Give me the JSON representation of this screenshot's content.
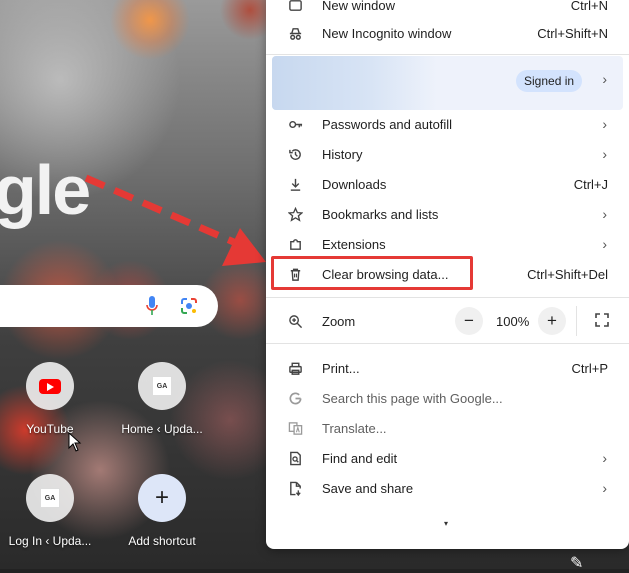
{
  "newtab": {
    "logo_fragment": "gle",
    "shortcuts": [
      {
        "label": "YouTube",
        "icon": "youtube-icon"
      },
      {
        "label": "Home ‹ Upda...",
        "icon": "site-favicon"
      },
      {
        "label": "Log In ‹ Upda...",
        "icon": "site-favicon"
      },
      {
        "label": "Add shortcut",
        "icon": "plus-icon"
      }
    ],
    "favicon_text": "GA",
    "add_glyph": "+"
  },
  "menu": {
    "new_window": {
      "label": "New window",
      "shortcut": "Ctrl+N"
    },
    "new_incognito": {
      "label": "New Incognito window",
      "shortcut": "Ctrl+Shift+N"
    },
    "profile": {
      "badge": "Signed in"
    },
    "passwords": {
      "label": "Passwords and autofill"
    },
    "history": {
      "label": "History"
    },
    "downloads": {
      "label": "Downloads",
      "shortcut": "Ctrl+J"
    },
    "bookmarks": {
      "label": "Bookmarks and lists"
    },
    "extensions": {
      "label": "Extensions"
    },
    "clear_data": {
      "label": "Clear browsing data...",
      "shortcut": "Ctrl+Shift+Del"
    },
    "zoom": {
      "label": "Zoom",
      "minus": "−",
      "value": "100%",
      "plus": "+"
    },
    "print": {
      "label": "Print...",
      "shortcut": "Ctrl+P"
    },
    "search_page": {
      "label": "Search this page with Google..."
    },
    "translate": {
      "label": "Translate..."
    },
    "find_edit": {
      "label": "Find and edit"
    },
    "save_share": {
      "label": "Save and share"
    },
    "chevron": "›",
    "more_caret": "▾"
  },
  "colors": {
    "annotation_red": "#e53935",
    "signed_in_badge": "#d3e3fd"
  }
}
